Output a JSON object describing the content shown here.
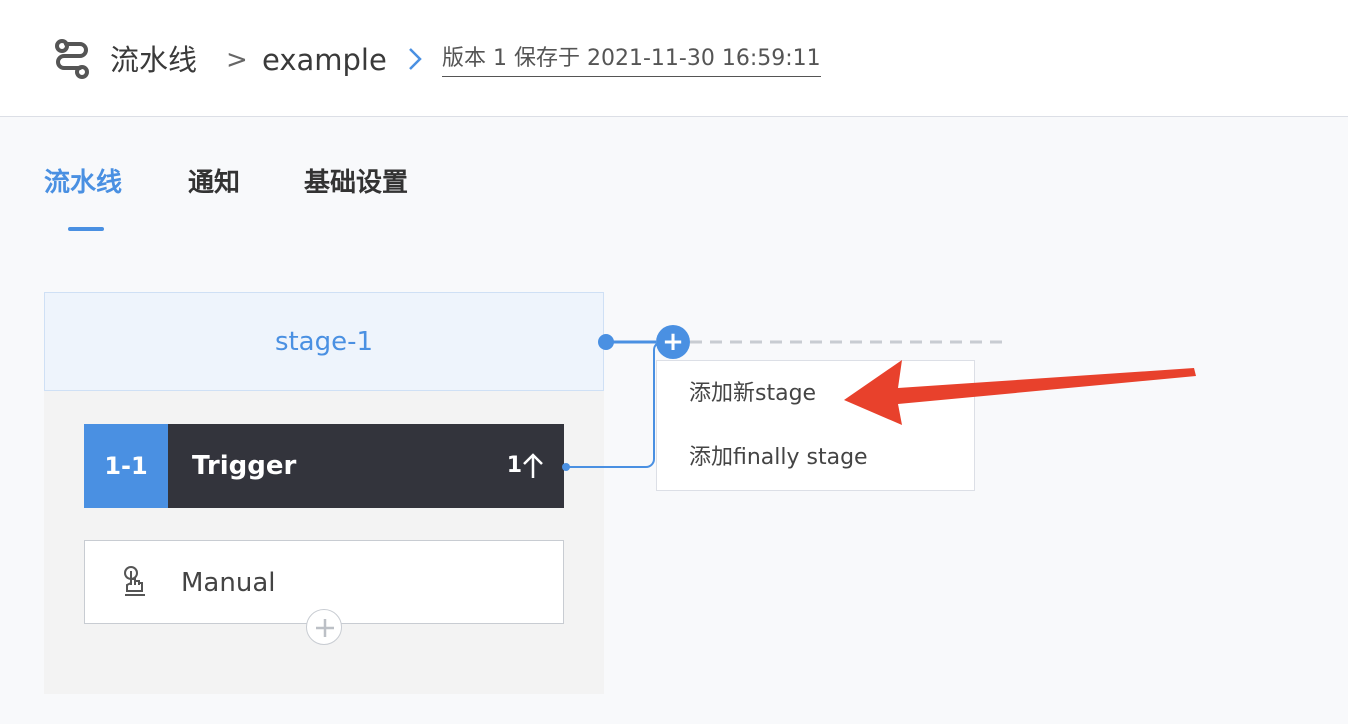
{
  "header": {
    "breadcrumb_root": "流水线",
    "separator": ">",
    "pipeline_name": "example",
    "version_text": "版本 1 保存于 2021-11-30 16:59:11"
  },
  "tabs": [
    {
      "label": "流水线",
      "active": true
    },
    {
      "label": "通知",
      "active": false
    },
    {
      "label": "基础设置",
      "active": false
    }
  ],
  "stage": {
    "name": "stage-1",
    "task": {
      "index": "1-1",
      "name": "Trigger",
      "count": "1"
    },
    "trigger": {
      "label": "Manual"
    }
  },
  "add_stage_menu": {
    "button_symbol": "+",
    "items": [
      "添加新stage",
      "添加finally stage"
    ]
  },
  "colors": {
    "accent": "#4a90e2",
    "task_bg": "#33343c",
    "annotation_arrow": "#e8412c"
  }
}
